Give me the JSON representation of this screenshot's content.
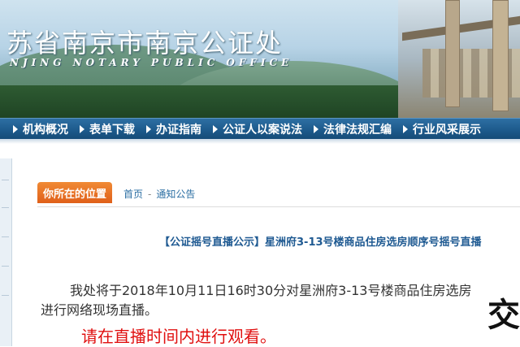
{
  "header": {
    "title": "苏省南京市南京公证处",
    "subtitle": "NJING NOTARY PUBLIC OFFICE"
  },
  "nav": {
    "items": [
      "机构概况",
      "表单下载",
      "办证指南",
      "公证人以案说法",
      "法律法规汇编",
      "行业风采展示"
    ]
  },
  "location": {
    "label": "你所在的位置",
    "breadcrumbs": [
      "首页",
      "通知公告"
    ]
  },
  "article": {
    "title": "【公证摇号直播公示】星洲府3-13号楼商品住房选房顺序号摇号直播",
    "line1": "我处将于2018年10月11日16时30分对星洲府3-13号楼商品住房选房",
    "line2": "进行网络现场直播。",
    "highlight": "请在直播时间内进行观看。"
  },
  "watermark": "交"
}
